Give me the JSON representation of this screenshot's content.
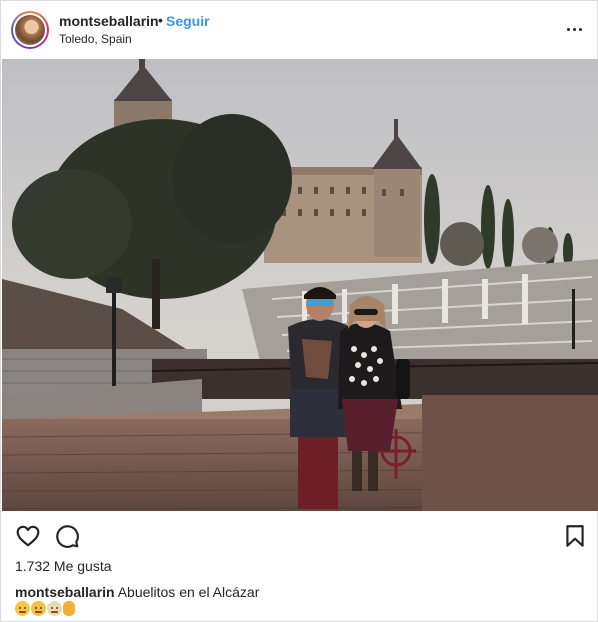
{
  "post": {
    "username": "montseballarin",
    "separator": "•",
    "follow_label": "Seguir",
    "location": "Toledo, Spain",
    "more_icon": "more-horizontal-icon",
    "likes_text": "1.732 Me gusta",
    "caption_username": "montseballarin",
    "caption_text": "Abuelitos en el Alcázar",
    "emojis": [
      "older-woman-emoji",
      "older-man-emoji",
      "older-adult-emoji",
      "ok-hand-emoji"
    ]
  },
  "icons": {
    "like": "heart-icon",
    "comment": "comment-icon",
    "save": "bookmark-icon"
  },
  "colors": {
    "text": "#262626",
    "follow": "#3897f0",
    "border": "#dbdbdb"
  }
}
